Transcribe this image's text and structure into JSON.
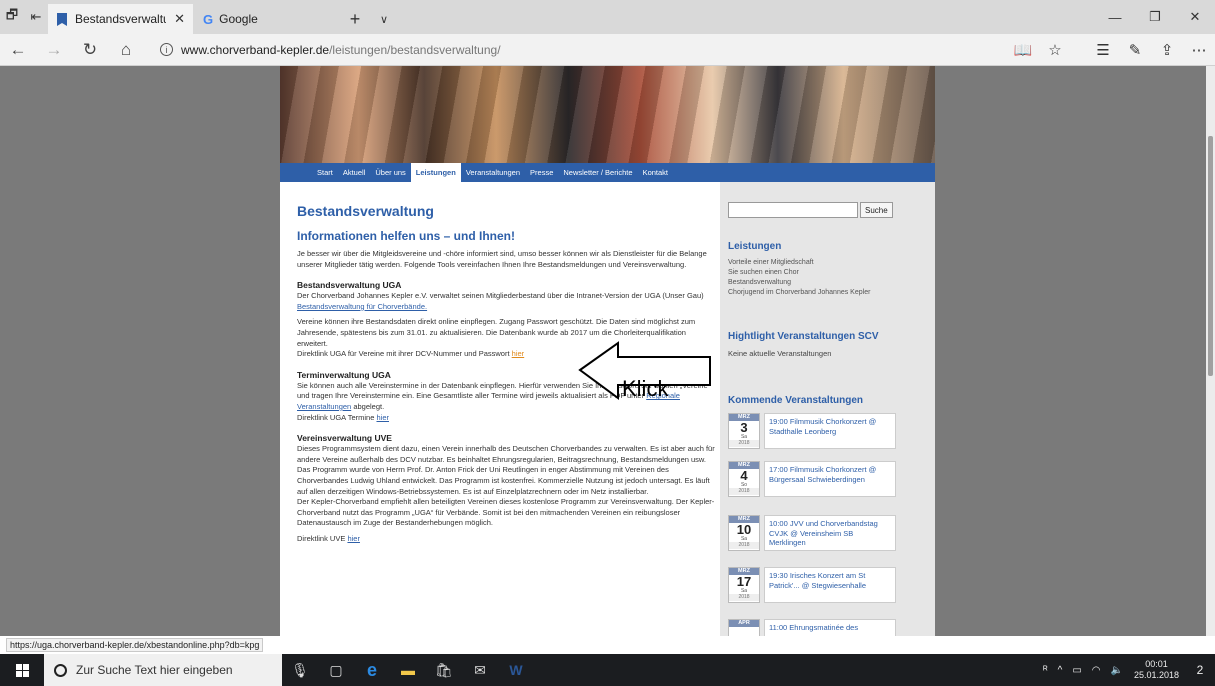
{
  "browser": {
    "tabs": [
      {
        "title": "Bestandsverwaltung › C",
        "active": true
      },
      {
        "title": "Google",
        "active": false
      }
    ],
    "address": {
      "host": "www.chorverband-kepler.de",
      "path": "/leistungen/bestandsverwaltung/"
    },
    "status_url": "https://uga.chorverband-kepler.de/xbestandonline.php?db=kpg"
  },
  "site": {
    "nav": [
      "Start",
      "Aktuell",
      "Über uns",
      "Leistungen",
      "Veranstaltungen",
      "Presse",
      "Newsletter / Berichte",
      "Kontakt"
    ],
    "active_nav": "Leistungen",
    "page_title": "Bestandsverwaltung",
    "headline": "Informationen helfen uns – und Ihnen!",
    "intro": "Je besser wir über die Mitgleidsvereine und -chöre informiert sind, umso besser können wir als Dienstleister für die Belange unserer Mitglieder tätig werden. Folgende Tools vereinfachen Ihnen Ihre Bestandsmeldungen und Vereinsverwaltung.",
    "sections": {
      "uga": {
        "heading": "Bestandsverwaltung UGA",
        "p1": "Der Chorverband Johannes Kepler e.V. verwaltet seinen Mitgliederbestand über die Intranet-Version der UGA (Unser Gau)",
        "p1_link": "Bestandsverwaltung für Chorverbände.",
        "p2": "Vereine können ihre Bestandsdaten direkt online einpflegen. Zugang Passwort geschützt. Die Daten sind möglichst zum Jahresende, spätestens bis zum 31.01. zu aktualisieren. Die Datenbank wurde ab 2017 um die Chorleiterqualifikation erweitert.",
        "p3": "Direktlink UGA für Vereine mit ihrer DCV-Nummer und Passwort",
        "p3_link": "hier"
      },
      "termin": {
        "heading": "Terminverwaltung UGA",
        "p1": "Sie können auch alle Vereinstermine in der Datenbank einpflegen. Hierfür verwenden Sie Ihr Passwort. Sie wählen „Vereine“ und tragen Ihre Vereinstermine ein. Eine Gesamtliste aller Termine wird jeweils aktualisiert als PDF unter",
        "p1_link": "Regionale Veranstaltungen",
        "p1_tail": "abgelegt.",
        "p2": "Direktlink UGA Termine",
        "p2_link": "hier"
      },
      "uve": {
        "heading": "Vereinsverwaltung UVE",
        "p1": "Dieses Programmsystem dient dazu, einen Verein innerhalb des Deutschen Chorverbandes zu verwalten. Es ist aber auch für andere Vereine außerhalb des DCV nutzbar. Es beinhaltet Ehrungsregularien, Beitragsrechnung, Bestandsmeldungen usw. Das Programm wurde von Herrn Prof. Dr. Anton Frick der Uni Reutlingen in enger Abstimmung mit Vereinen des Chorverbandes Ludwig Uhland entwickelt. Das Programm ist kostenfrei. Kommerzielle Nutzung ist jedoch untersagt. Es läuft auf allen derzeitigen Windows-Betriebssystemen. Es ist auf Einzelplatzrechnern oder im Netz installierbar.",
        "p2": "Der Kepler-Chorverband empfiehlt allen beteiligten Vereinen dieses kostenlose Programm zur Vereinsverwaltung. Der Kepler-Chorverband nutzt das Programm „UGA“ für Verbände. Somit ist bei den mitmachenden Vereinen ein reibungsloser Datenaustausch im Zuge der Bestanderhebungen möglich.",
        "p3": "Direktlink UVE",
        "p3_link": "hier"
      }
    },
    "sidebar": {
      "search_button": "Suche",
      "leistungen_heading": "Leistungen",
      "leistungen_links": [
        "Vorteile einer Mitgliedschaft",
        "Sie suchen einen Chor",
        "Bestandsverwaltung",
        "Chorjugend im Chorverband Johannes Kepler"
      ],
      "highlight_heading": "Hightlight Veranstaltungen SCV",
      "highlight_none": "Keine aktuelle Veranstaltungen",
      "upcoming_heading": "Kommende Veranstaltungen",
      "events": [
        {
          "month": "MRZ",
          "day": "3",
          "weekday": "Sa",
          "year": "2018",
          "text": "19:00 Filmmusik Chorkonzert @ Stadthalle Leonberg"
        },
        {
          "month": "MRZ",
          "day": "4",
          "weekday": "So",
          "year": "2018",
          "text": "17:00 Filmmusik Chorkonzert @ Bürgersaal Schwieberdingen"
        },
        {
          "month": "MRZ",
          "day": "10",
          "weekday": "Sa",
          "year": "2018",
          "text": "10:00 JVV und Chorverbandstag CVJK @ Vereinsheim SB Merklingen"
        },
        {
          "month": "MRZ",
          "day": "17",
          "weekday": "Sa",
          "year": "2018",
          "text": "19:30 Irisches Konzert am St Patrick'... @ Stegwiesenhalle"
        },
        {
          "month": "APR",
          "day": "",
          "weekday": "",
          "year": "",
          "text": "11:00 Ehrungsmatinée des"
        }
      ]
    }
  },
  "annotation": {
    "label": "Klick"
  },
  "taskbar": {
    "search_placeholder": "Zur Suche Text hier eingeben",
    "time": "00:01",
    "date": "25.01.2018",
    "notifications": "2"
  }
}
